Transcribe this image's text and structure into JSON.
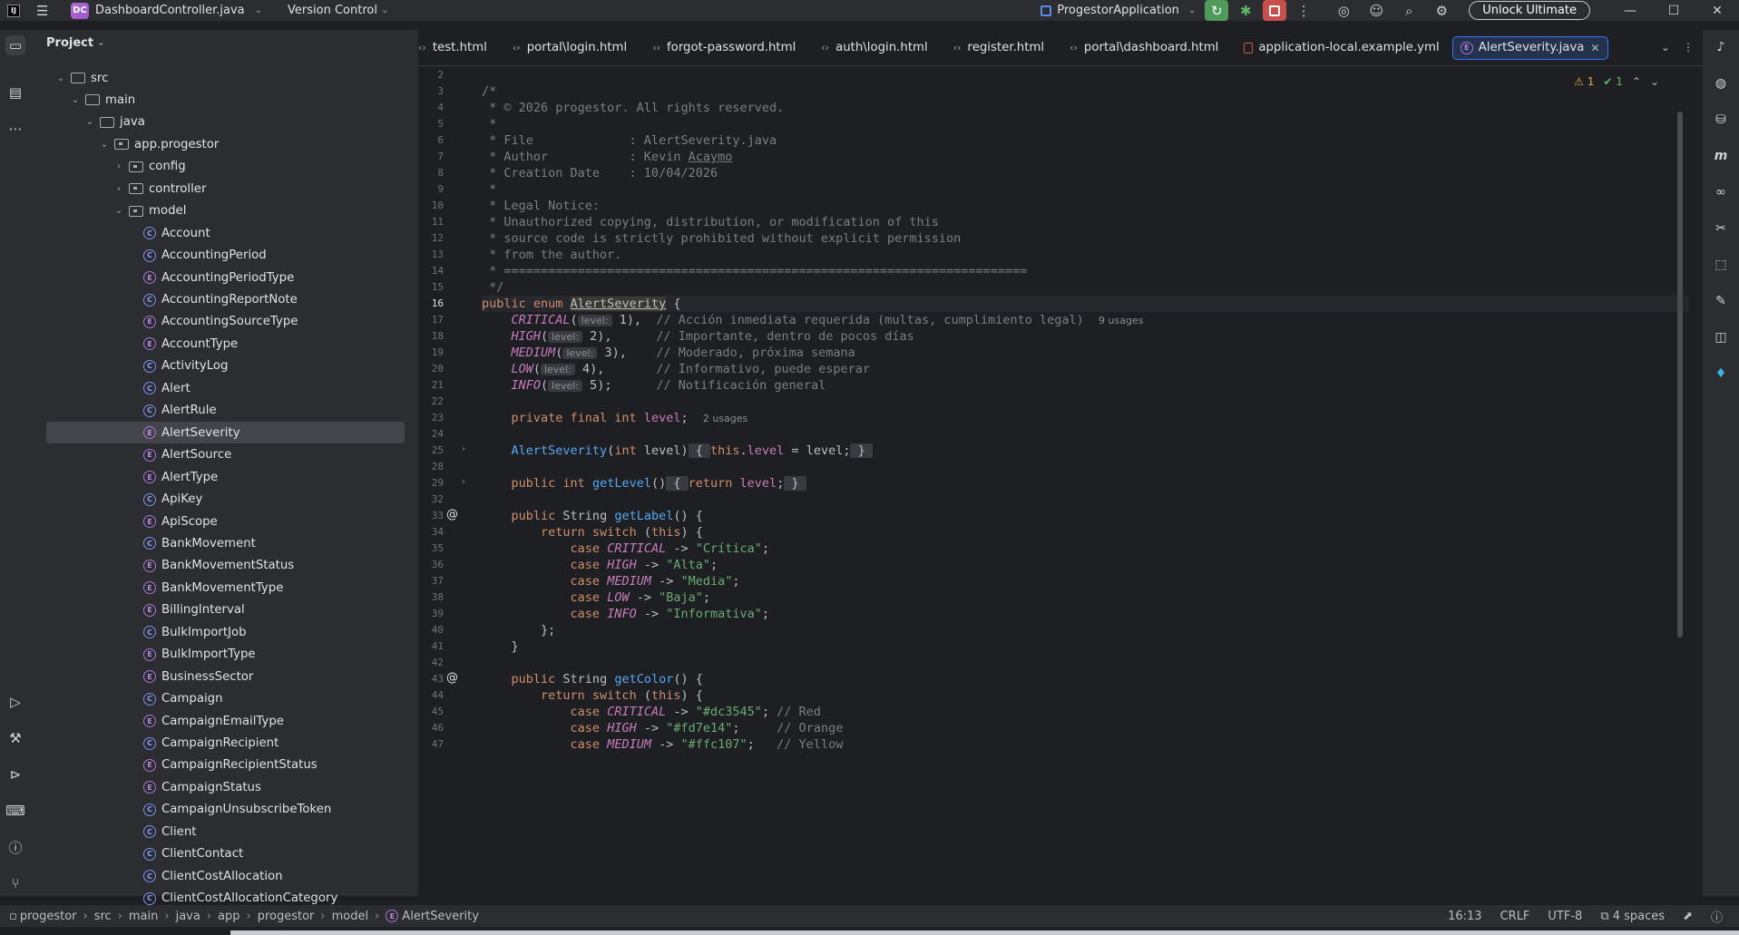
{
  "titlebar": {
    "project_badge": "DC",
    "project_name": "DashboardController.java",
    "vcs_label": "Version Control",
    "run_config": "ProgestorApplication",
    "unlock_label": "Unlock Ultimate"
  },
  "project_panel": {
    "title": "Project",
    "tree": [
      {
        "label": "src",
        "depth": 0,
        "kind": "folder",
        "expanded": true
      },
      {
        "label": "main",
        "depth": 1,
        "kind": "folder",
        "expanded": true
      },
      {
        "label": "java",
        "depth": 2,
        "kind": "folder",
        "expanded": true
      },
      {
        "label": "app.progestor",
        "depth": 3,
        "kind": "package",
        "expanded": true
      },
      {
        "label": "config",
        "depth": 4,
        "kind": "package",
        "expanded": false
      },
      {
        "label": "controller",
        "depth": 4,
        "kind": "package",
        "expanded": false
      },
      {
        "label": "model",
        "depth": 4,
        "kind": "package",
        "expanded": true
      },
      {
        "label": "Account",
        "depth": 5,
        "kind": "class"
      },
      {
        "label": "AccountingPeriod",
        "depth": 5,
        "kind": "class"
      },
      {
        "label": "AccountingPeriodType",
        "depth": 5,
        "kind": "enum"
      },
      {
        "label": "AccountingReportNote",
        "depth": 5,
        "kind": "class"
      },
      {
        "label": "AccountingSourceType",
        "depth": 5,
        "kind": "enum"
      },
      {
        "label": "AccountType",
        "depth": 5,
        "kind": "enum"
      },
      {
        "label": "ActivityLog",
        "depth": 5,
        "kind": "class"
      },
      {
        "label": "Alert",
        "depth": 5,
        "kind": "class"
      },
      {
        "label": "AlertRule",
        "depth": 5,
        "kind": "class"
      },
      {
        "label": "AlertSeverity",
        "depth": 5,
        "kind": "enum",
        "selected": true
      },
      {
        "label": "AlertSource",
        "depth": 5,
        "kind": "enum"
      },
      {
        "label": "AlertType",
        "depth": 5,
        "kind": "enum"
      },
      {
        "label": "ApiKey",
        "depth": 5,
        "kind": "class"
      },
      {
        "label": "ApiScope",
        "depth": 5,
        "kind": "enum"
      },
      {
        "label": "BankMovement",
        "depth": 5,
        "kind": "class"
      },
      {
        "label": "BankMovementStatus",
        "depth": 5,
        "kind": "enum"
      },
      {
        "label": "BankMovementType",
        "depth": 5,
        "kind": "enum"
      },
      {
        "label": "BillingInterval",
        "depth": 5,
        "kind": "enum"
      },
      {
        "label": "BulkImportJob",
        "depth": 5,
        "kind": "class"
      },
      {
        "label": "BulkImportType",
        "depth": 5,
        "kind": "enum"
      },
      {
        "label": "BusinessSector",
        "depth": 5,
        "kind": "enum"
      },
      {
        "label": "Campaign",
        "depth": 5,
        "kind": "class"
      },
      {
        "label": "CampaignEmailType",
        "depth": 5,
        "kind": "enum"
      },
      {
        "label": "CampaignRecipient",
        "depth": 5,
        "kind": "class"
      },
      {
        "label": "CampaignRecipientStatus",
        "depth": 5,
        "kind": "enum"
      },
      {
        "label": "CampaignStatus",
        "depth": 5,
        "kind": "enum"
      },
      {
        "label": "CampaignUnsubscribeToken",
        "depth": 5,
        "kind": "class"
      },
      {
        "label": "Client",
        "depth": 5,
        "kind": "class"
      },
      {
        "label": "ClientContact",
        "depth": 5,
        "kind": "class"
      },
      {
        "label": "ClientCostAllocation",
        "depth": 5,
        "kind": "class"
      },
      {
        "label": "ClientCostAllocationCategory",
        "depth": 5,
        "kind": "class"
      }
    ]
  },
  "tabs": [
    {
      "label": "test.html",
      "kind": "html"
    },
    {
      "label": "portal\\login.html",
      "kind": "html"
    },
    {
      "label": "forgot-password.html",
      "kind": "html"
    },
    {
      "label": "auth\\login.html",
      "kind": "html"
    },
    {
      "label": "register.html",
      "kind": "html"
    },
    {
      "label": "portal\\dashboard.html",
      "kind": "html"
    },
    {
      "label": "application-local.example.yml",
      "kind": "yml"
    },
    {
      "label": "AlertSeverity.java",
      "kind": "java",
      "active": true
    }
  ],
  "inspections": {
    "warnings": "1",
    "ok": "1"
  },
  "editor": {
    "current_line": "16",
    "lines": [
      {
        "n": "2",
        "html": ""
      },
      {
        "n": "3",
        "html": "<span class='cm'>/*</span>"
      },
      {
        "n": "4",
        "html": "<span class='cm'> * © 2026 progestor. All rights reserved.</span>"
      },
      {
        "n": "5",
        "html": "<span class='cm'> *</span>"
      },
      {
        "n": "6",
        "html": "<span class='cm'> * File             : AlertSeverity.java</span>"
      },
      {
        "n": "7",
        "html": "<span class='cm'> * Author           : Kevin <span class='uline'>Acaymo</span></span>"
      },
      {
        "n": "8",
        "html": "<span class='cm'> * Creation Date    : 10/04/2026</span>"
      },
      {
        "n": "9",
        "html": "<span class='cm'> *</span>"
      },
      {
        "n": "10",
        "html": "<span class='cm'> * Legal Notice:</span>"
      },
      {
        "n": "11",
        "html": "<span class='cm'> * Unauthorized copying, distribution, or modification of this</span>"
      },
      {
        "n": "12",
        "html": "<span class='cm'> * source code is strictly prohibited without explicit permission</span>"
      },
      {
        "n": "13",
        "html": "<span class='cm'> * from the author.</span>"
      },
      {
        "n": "14",
        "html": "<span class='cm'> * =======================================================================</span>"
      },
      {
        "n": "15",
        "html": "<span class='cm'> */</span>"
      },
      {
        "n": "16",
        "html": "<span class='kw'>public enum</span> <span class='hl'>AlertSeverity</span> {"
      },
      {
        "n": "17",
        "html": "    <span class='enc'>CRITICAL</span>(<span class='hint'>level:</span> 1),  <span class='cm'>// Acción inmediata requerida (multas, cumplimiento legal)</span>  <span class='usages'>9 usages</span>"
      },
      {
        "n": "18",
        "html": "    <span class='enc'>HIGH</span>(<span class='hint'>level:</span> 2),      <span class='cm'>// Importante, dentro de pocos días</span>"
      },
      {
        "n": "19",
        "html": "    <span class='enc'>MEDIUM</span>(<span class='hint'>level:</span> 3),    <span class='cm'>// Moderado, próxima semana</span>"
      },
      {
        "n": "20",
        "html": "    <span class='enc'>LOW</span>(<span class='hint'>level:</span> 4),       <span class='cm'>// Informativo, puede esperar</span>"
      },
      {
        "n": "21",
        "html": "    <span class='enc'>INFO</span>(<span class='hint'>level:</span> 5);      <span class='cm'>// Notificación general</span>"
      },
      {
        "n": "22",
        "html": ""
      },
      {
        "n": "23",
        "html": "    <span class='kw'>private final int</span> <span class='fld'>level</span>;  <span class='usages'>2 usages</span>"
      },
      {
        "n": "24",
        "html": ""
      },
      {
        "n": "25",
        "html": "    <span class='fn'>AlertSeverity</span>(<span class='kw'>int</span> level)<span class='foldbox'> { </span><span class='kw'>this</span>.<span class='fld'>level</span> = level;<span class='foldbox'> } </span>"
      },
      {
        "n": "28",
        "html": ""
      },
      {
        "n": "29",
        "html": "    <span class='kw'>public int</span> <span class='fn'>getLevel</span>()<span class='foldbox'> { </span><span class='kw'>return</span> <span class='fld'>level</span>;<span class='foldbox'> } </span>"
      },
      {
        "n": "32",
        "html": ""
      },
      {
        "n": "33",
        "html": "    <span class='kw'>public</span> String <span class='fn'>getLabel</span>() {"
      },
      {
        "n": "34",
        "html": "        <span class='kw'>return switch</span> (<span class='kw'>this</span>) {"
      },
      {
        "n": "35",
        "html": "            <span class='kw'>case</span> <span class='enc'>CRITICAL</span> -> <span class='str'>\"Crítica\"</span>;"
      },
      {
        "n": "36",
        "html": "            <span class='kw'>case</span> <span class='enc'>HIGH</span> -> <span class='str'>\"Alta\"</span>;"
      },
      {
        "n": "37",
        "html": "            <span class='kw'>case</span> <span class='enc'>MEDIUM</span> -> <span class='str'>\"Media\"</span>;"
      },
      {
        "n": "38",
        "html": "            <span class='kw'>case</span> <span class='enc'>LOW</span> -> <span class='str'>\"Baja\"</span>;"
      },
      {
        "n": "39",
        "html": "            <span class='kw'>case</span> <span class='enc'>INFO</span> -> <span class='str'>\"Informativa\"</span>;"
      },
      {
        "n": "40",
        "html": "        };"
      },
      {
        "n": "41",
        "html": "    }"
      },
      {
        "n": "42",
        "html": ""
      },
      {
        "n": "43",
        "html": "    <span class='kw'>public</span> String <span class='fn'>getColor</span>() {"
      },
      {
        "n": "44",
        "html": "        <span class='kw'>return switch</span> (<span class='kw'>this</span>) {"
      },
      {
        "n": "45",
        "html": "            <span class='kw'>case</span> <span class='enc'>CRITICAL</span> -> <span class='str'>\"#dc3545\"</span>; <span class='cm'>// Red</span>"
      },
      {
        "n": "46",
        "html": "            <span class='kw'>case</span> <span class='enc'>HIGH</span> -> <span class='str'>\"#fd7e14\"</span>;     <span class='cm'>// Orange</span>"
      },
      {
        "n": "47",
        "html": "            <span class='kw'>case</span> <span class='enc'>MEDIUM</span> -> <span class='str'>\"#ffc107\"</span>;   <span class='cm'>// Yellow</span>"
      }
    ]
  },
  "statusbar": {
    "breadcrumbs": [
      "progestor",
      "src",
      "main",
      "java",
      "app",
      "progestor",
      "model",
      "AlertSeverity"
    ],
    "position": "16:13",
    "line_separator": "CRLF",
    "encoding": "UTF-8",
    "indent": "4 spaces"
  }
}
